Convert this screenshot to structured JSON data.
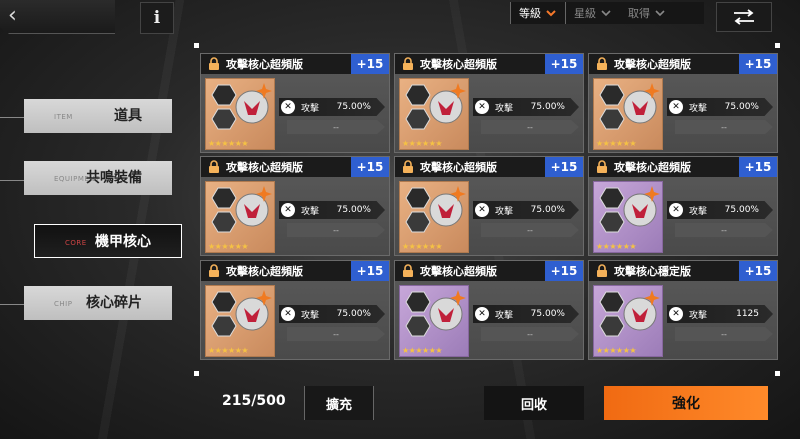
{
  "header": {
    "back_icon": "chevron-left-icon",
    "info_label": "i",
    "sort_tabs": [
      {
        "label": "等級",
        "active": true
      },
      {
        "label": "星級",
        "active": false
      },
      {
        "label": "取得",
        "active": false
      }
    ],
    "swap_icon": "swap-arrows-icon"
  },
  "sidebar": {
    "items": [
      {
        "tag": "ITEM",
        "label": "道具",
        "active": false
      },
      {
        "tag": "EQUIPMENT",
        "label": "共鳴裝備",
        "active": false
      },
      {
        "tag": "CORE",
        "label": "機甲核心",
        "active": true
      },
      {
        "tag": "CHIP",
        "label": "核心碎片",
        "active": false
      }
    ]
  },
  "cards": [
    {
      "name": "攻擊核心超頻版",
      "level": "+15",
      "stat_label": "攻擊",
      "stat_value": "75.00%",
      "sub": "--",
      "stars": "★★★★★★",
      "variant": "orange"
    },
    {
      "name": "攻擊核心超頻版",
      "level": "+15",
      "stat_label": "攻擊",
      "stat_value": "75.00%",
      "sub": "--",
      "stars": "★★★★★★",
      "variant": "orange"
    },
    {
      "name": "攻擊核心超頻版",
      "level": "+15",
      "stat_label": "攻擊",
      "stat_value": "75.00%",
      "sub": "--",
      "stars": "★★★★★★",
      "variant": "orange"
    },
    {
      "name": "攻擊核心超頻版",
      "level": "+15",
      "stat_label": "攻擊",
      "stat_value": "75.00%",
      "sub": "--",
      "stars": "★★★★★★",
      "variant": "orange"
    },
    {
      "name": "攻擊核心超頻版",
      "level": "+15",
      "stat_label": "攻擊",
      "stat_value": "75.00%",
      "sub": "--",
      "stars": "★★★★★★",
      "variant": "orange"
    },
    {
      "name": "攻擊核心超頻版",
      "level": "+15",
      "stat_label": "攻擊",
      "stat_value": "75.00%",
      "sub": "--",
      "stars": "★★★★★★",
      "variant": "purple"
    },
    {
      "name": "攻擊核心超頻版",
      "level": "+15",
      "stat_label": "攻擊",
      "stat_value": "75.00%",
      "sub": "--",
      "stars": "★★★★★★",
      "variant": "orange"
    },
    {
      "name": "攻擊核心超頻版",
      "level": "+15",
      "stat_label": "攻擊",
      "stat_value": "75.00%",
      "sub": "--",
      "stars": "★★★★★★",
      "variant": "purple"
    },
    {
      "name": "攻擊核心穩定版",
      "level": "+15",
      "stat_label": "攻擊",
      "stat_value": "1125",
      "sub": "--",
      "stars": "★★★★★★",
      "variant": "purple"
    }
  ],
  "footer": {
    "capacity": "215/500",
    "expand_label": "擴充",
    "recycle_label": "回收",
    "enhance_label": "強化"
  },
  "colors": {
    "accent_orange": "#f5782a",
    "level_badge_blue": "#2f5fd0",
    "star_gold": "#f5c244"
  }
}
